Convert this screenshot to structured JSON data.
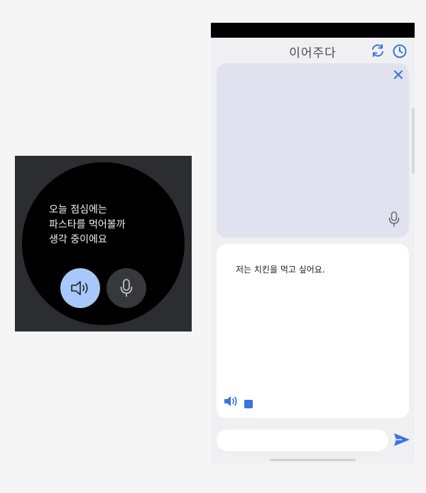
{
  "watch": {
    "message": "오늘 점심에는\n파스타를 먹어볼까\n생각 중이에요",
    "speaker_button": {
      "icon": "speaker-icon",
      "color": "#a8c7fa"
    },
    "mic_button": {
      "icon": "mic-icon",
      "color": "#36383b"
    }
  },
  "phone": {
    "header": {
      "logo_text": "이어주다",
      "refresh_icon": "refresh-icon",
      "history_icon": "history-icon",
      "accent": "#3a74dd"
    },
    "listen_panel": {
      "close_icon": "close-icon",
      "mic_icon": "mic-icon",
      "background": "#e0e3ef"
    },
    "speech_card": {
      "text": "저는 치킨을 먹고 싶어요.",
      "play_icon": "speaker-icon",
      "stop_icon": "stop-icon"
    },
    "input": {
      "placeholder": "",
      "value": "",
      "send_icon": "send-icon"
    }
  }
}
